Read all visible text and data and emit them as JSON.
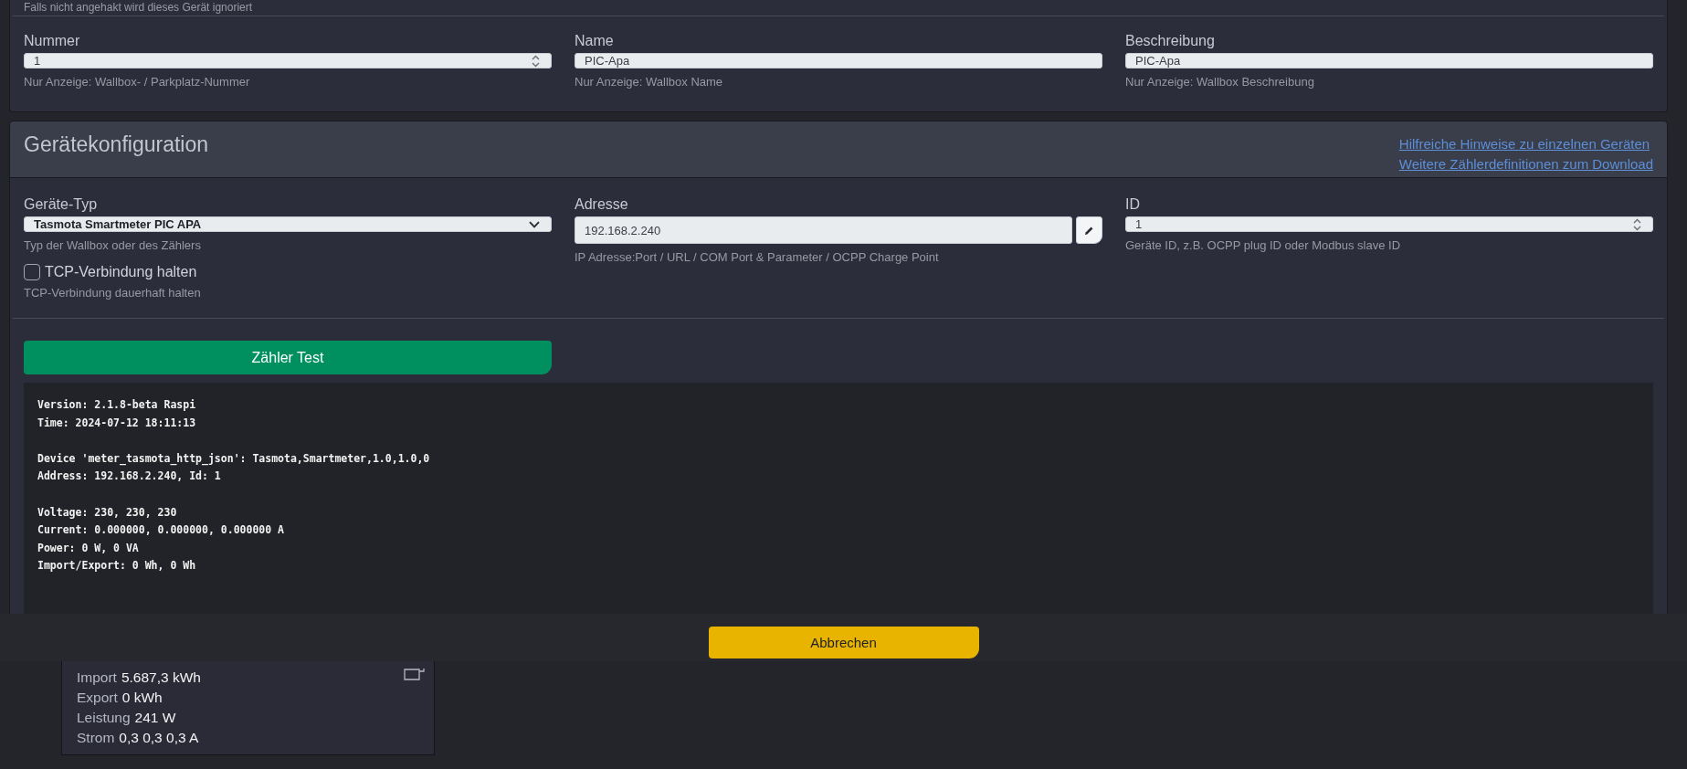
{
  "general_panel": {
    "note": "Falls nicht angehakt wird dieses Gerät ignoriert",
    "fields": [
      {
        "kind": "number",
        "label": "Nummer",
        "value": "1",
        "help": "Nur Anzeige: Wallbox- / Parkplatz-Nummer"
      },
      {
        "kind": "text",
        "label": "Name",
        "value": "PIC-Apa",
        "help": "Nur Anzeige: Wallbox Name"
      },
      {
        "kind": "text",
        "label": "Beschreibung",
        "value": "PIC-Apa",
        "help": "Nur Anzeige: Wallbox Beschreibung"
      }
    ]
  },
  "device_panel": {
    "title": "Gerätekonfiguration",
    "links": [
      "Hilfreiche Hinweise zu einzelnen Geräten",
      "Weitere Zählerdefinitionen zum Download"
    ],
    "fields": [
      {
        "kind": "select",
        "label": "Geräte-Typ",
        "value": "Tasmota Smartmeter PIC APA",
        "help": "Typ der Wallbox oder des Zählers"
      },
      {
        "kind": "editable",
        "label": "Adresse",
        "value": "192.168.2.240",
        "help": "IP Adresse:Port / URL / COM Port & Parameter / OCPP Charge Point"
      },
      {
        "kind": "number",
        "label": "ID",
        "value": "1",
        "help": "Geräte ID, z.B. OCPP plug ID oder Modbus slave ID"
      }
    ],
    "keep_connection": {
      "label": "TCP-Verbindung halten",
      "checked": false,
      "help": "TCP-Verbindung dauerhaft halten"
    },
    "test_button": "Zähler Test",
    "console_blocks": [
      [
        "Version: 2.1.8-beta Raspi",
        "Time: 2024-07-12 18:11:13"
      ],
      [
        "Device 'meter_tasmota_http_json': Tasmota,Smartmeter,1.0,1.0,0",
        "Address: 192.168.2.240, Id: 1"
      ],
      [
        "Voltage: 230, 230, 230",
        "Current: 0.000000, 0.000000, 0.000000 A",
        "Power: 0 W, 0 VA",
        "Import/Export: 0 Wh, 0 Wh"
      ]
    ]
  },
  "footer": {
    "cancel_button": "Abbrechen"
  },
  "meter_card": {
    "rows": [
      {
        "label": "Import",
        "value": "5.687,3 kWh"
      },
      {
        "label": "Export",
        "value": "0 kWh"
      },
      {
        "label": "Leistung",
        "value": "241 W"
      },
      {
        "label": "Strom",
        "value": "0,3 0,3 0,3 A"
      }
    ]
  }
}
